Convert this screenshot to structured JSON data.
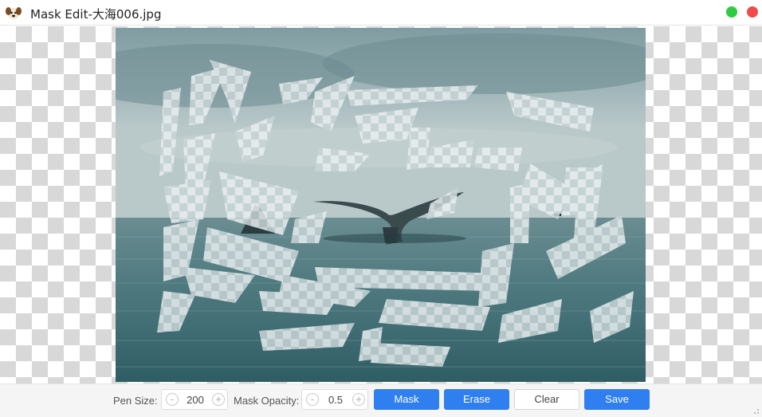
{
  "window": {
    "title": "Mask Edit-大海006.jpg",
    "app_icon": "dog-face-icon",
    "controls": {
      "maximize": "green-dot",
      "close": "red-dot"
    }
  },
  "toolbar": {
    "pen_size_label": "Pen Size:",
    "pen_size_value": "200",
    "mask_opacity_label": "Mask Opacity:",
    "mask_opacity_value": "0.5",
    "decrement_symbol": "-",
    "increment_symbol": "+",
    "mask_label": "Mask",
    "erase_label": "Erase",
    "clear_label": "Clear",
    "save_label": "Save"
  },
  "colors": {
    "accent": "#2f7ff0",
    "sea_dark": "#3f6e74",
    "sky": "#a7bcc0",
    "checker": "#d8d8d8"
  }
}
